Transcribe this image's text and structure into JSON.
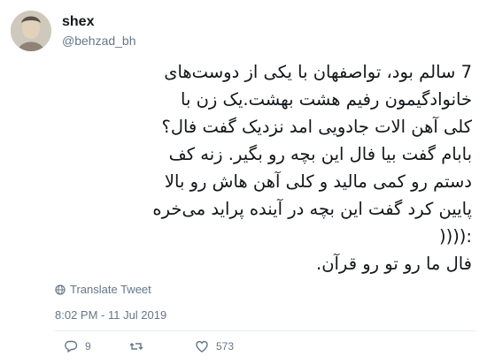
{
  "user": {
    "display_name": "shex",
    "handle": "@behzad_bh"
  },
  "tweet": {
    "lines": [
      "7 سالم بود، تواصفهان با یکی از دوست‌های",
      "خانوادگیمون رفیم هشت بهشت.یک زن با",
      "کلی آهن الات جادویی امد نزدیک گفت فال؟",
      "بابام گفت بیا فال این بچه رو بگیر. زنه کف",
      "دستم رو کمی مالید و کلی آهن هاش رو بالا",
      "پایین کرد گفت این بچه در آینده پراید می‌خره",
      ":((((",
      "فال ما رو تو رو قرآن."
    ],
    "translate_label": "Translate Tweet",
    "timestamp": "8:02 PM - 11 Jul 2019"
  },
  "actions": {
    "replies_count": "9",
    "retweets_count": "",
    "likes_count": "573"
  },
  "colors": {
    "text": "#14171a",
    "muted": "#657786",
    "divider": "#e6ecf0"
  },
  "icons": [
    "globe-icon",
    "reply-icon",
    "retweet-icon",
    "heart-icon"
  ]
}
